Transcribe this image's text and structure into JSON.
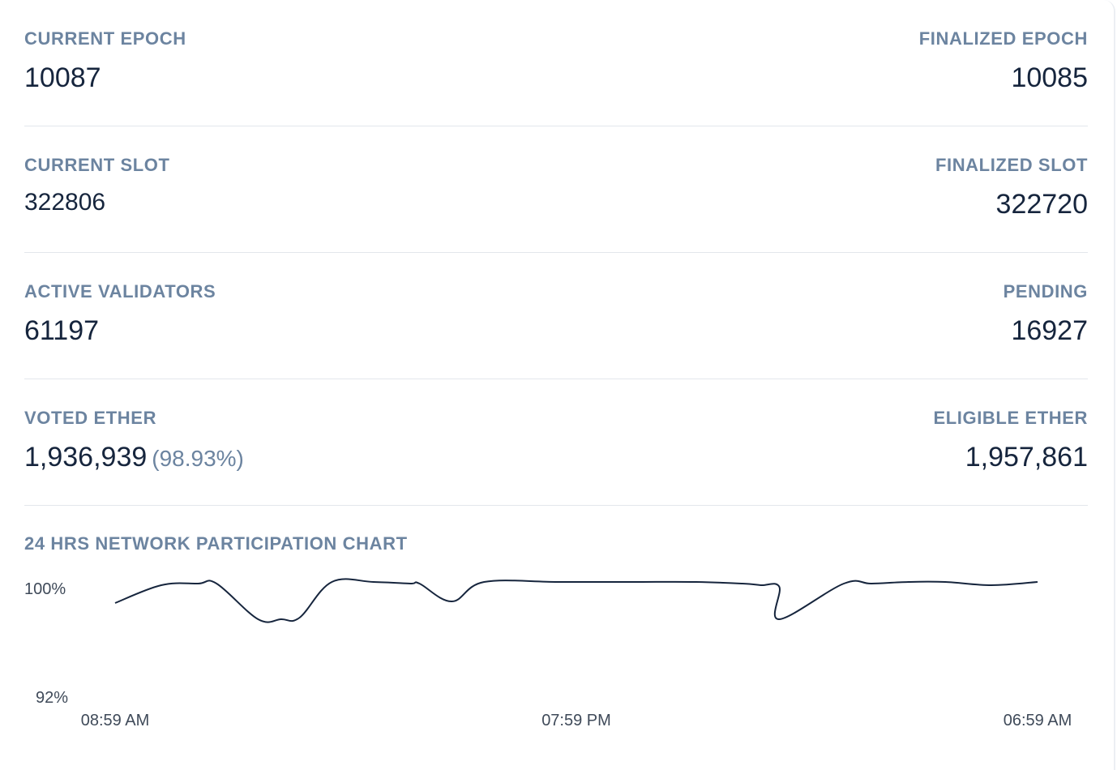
{
  "stats": {
    "current_epoch": {
      "label": "CURRENT EPOCH",
      "value": "10087"
    },
    "finalized_epoch": {
      "label": "FINALIZED EPOCH",
      "value": "10085"
    },
    "current_slot": {
      "label": "CURRENT SLOT",
      "value": "322806"
    },
    "finalized_slot": {
      "label": "FINALIZED SLOT",
      "value": "322720"
    },
    "active_validators": {
      "label": "ACTIVE VALIDATORS",
      "value": "61197"
    },
    "pending": {
      "label": "PENDING",
      "value": "16927"
    },
    "voted_ether": {
      "label": "VOTED ETHER",
      "value": "1,936,939",
      "percent": "(98.93%)"
    },
    "eligible_ether": {
      "label": "ELIGIBLE ETHER",
      "value": "1,957,861"
    }
  },
  "chart_title": "24 HRS NETWORK PARTICIPATION CHART",
  "chart_data": {
    "type": "line",
    "title": "24 HRS NETWORK PARTICIPATION CHART",
    "y_tick_labels": [
      "100%",
      "92%"
    ],
    "ylim": [
      92,
      100
    ],
    "x_tick_labels": [
      "08:59 AM",
      "07:59 PM",
      "06:59 AM"
    ],
    "line_color": "#16253d",
    "series": [
      {
        "values": [
          97.8,
          98.9,
          99.0,
          99.0,
          96.8,
          96.8,
          96.9,
          99.1,
          99.1,
          99.0,
          99.0,
          97.9,
          99.1,
          99.1,
          99.1,
          99.1,
          99.0,
          98.9,
          98.8,
          96.8,
          99.0,
          99.0,
          99.1,
          99.1,
          98.9,
          99.1
        ],
        "x_positions": [
          0.0,
          0.05,
          0.09,
          0.11,
          0.155,
          0.18,
          0.2,
          0.235,
          0.28,
          0.32,
          0.33,
          0.365,
          0.4,
          0.48,
          0.56,
          0.63,
          0.68,
          0.7,
          0.72,
          0.72,
          0.79,
          0.82,
          0.86,
          0.9,
          0.95,
          1.0
        ]
      }
    ]
  }
}
